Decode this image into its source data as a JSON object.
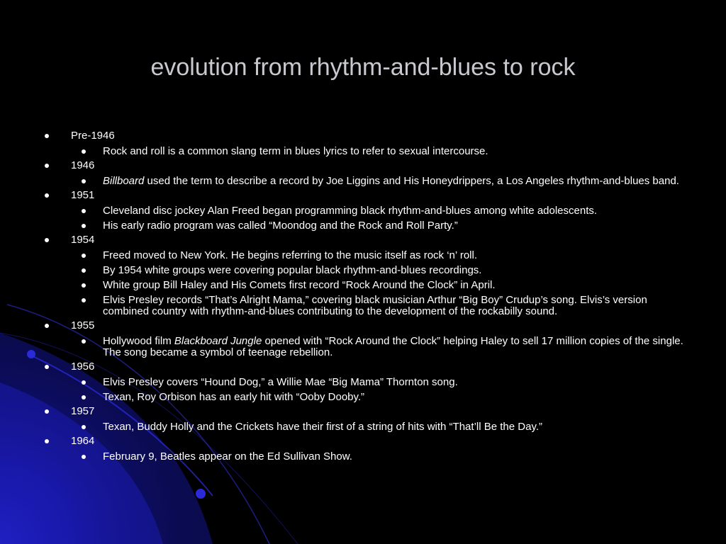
{
  "title": "evolution from rhythm-and-blues to rock",
  "colors": {
    "background": "#000000",
    "title": "#c8c8d0",
    "text": "#ffffff",
    "accent": "#1a1aa0"
  },
  "sections": [
    {
      "year": "Pre-1946",
      "items": [
        {
          "text": "Rock and roll is a common slang term in blues lyrics to refer to sexual intercourse."
        }
      ]
    },
    {
      "year": "1946",
      "items": [
        {
          "italic": "Billboard",
          "text": " used the term to describe a record by Joe Liggins and His Honeydrippers, a Los Angeles rhythm-and-blues band."
        }
      ]
    },
    {
      "year": "1951",
      "items": [
        {
          "text": "Cleveland disc jockey Alan Freed began programming black rhythm-and-blues among white adolescents."
        },
        {
          "text": "His early radio program was called “Moondog and the Rock and Roll Party.”"
        }
      ]
    },
    {
      "year": "1954",
      "items": [
        {
          "text": "Freed moved to New York.  He begins referring to the music itself as rock ‘n’ roll."
        },
        {
          "text": "By 1954 white groups were covering popular black rhythm-and-blues recordings."
        },
        {
          "text": "White group Bill Haley and His Comets first record “Rock Around the Clock” in April."
        },
        {
          "text": "Elvis Presley records “That’s Alright Mama,” covering black musician Arthur “Big Boy” Crudup’s song.  Elvis’s version combined country with rhythm-and-blues contributing to the development of the rockabilly sound."
        }
      ]
    },
    {
      "year": "1955",
      "items": [
        {
          "before": "Hollywood film ",
          "italic": "Blackboard Jungle",
          "text": " opened with “Rock Around the Clock” helping Haley to sell 17 million copies of the single.  The song became a symbol of teenage rebellion."
        }
      ]
    },
    {
      "year": "1956",
      "items": [
        {
          "text": "Elvis Presley covers “Hound Dog,” a Willie Mae “Big Mama” Thornton song."
        },
        {
          "text": "Texan, Roy Orbison has an early hit with “Ooby Dooby.”"
        }
      ]
    },
    {
      "year": "1957",
      "items": [
        {
          "text": "Texan, Buddy Holly and the Crickets have their first of a string of hits with “That’ll Be the Day.”"
        }
      ]
    },
    {
      "year": "1964",
      "items": [
        {
          "text": "February 9, Beatles appear on the Ed Sullivan Show."
        }
      ]
    }
  ]
}
